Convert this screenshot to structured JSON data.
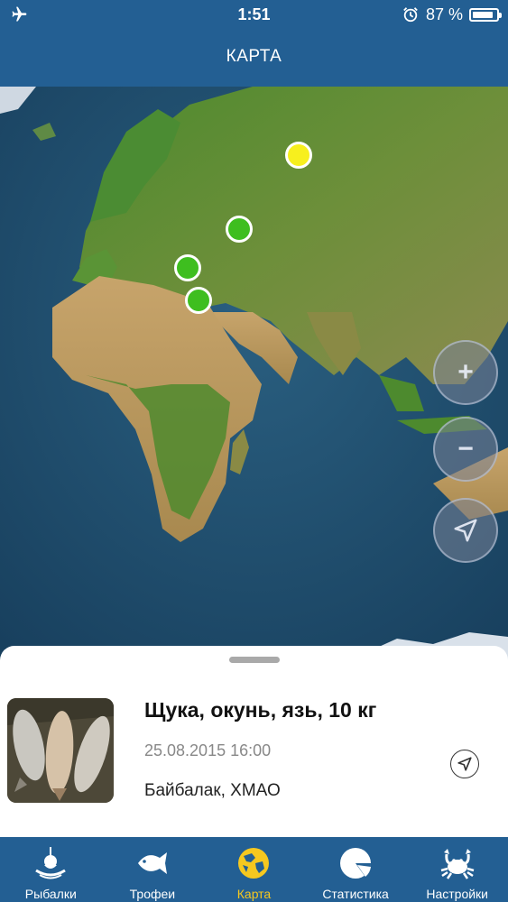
{
  "status_bar": {
    "time": "1:51",
    "battery_text": "87 %",
    "battery_level": 0.87,
    "left_icon": "airplane-icon",
    "alarm_icon": "alarm-icon"
  },
  "header": {
    "title": "КАРТА"
  },
  "map": {
    "markers": [
      {
        "color": "#f7ef1e",
        "icon": "catch-marker-yellow"
      },
      {
        "color": "#3ebe1f",
        "icon": "catch-marker-green"
      },
      {
        "color": "#3ebe1f",
        "icon": "catch-marker-green"
      },
      {
        "color": "#3ebe1f",
        "icon": "catch-marker-green"
      }
    ],
    "controls": [
      {
        "name": "zoom-in-button",
        "glyph": "+"
      },
      {
        "name": "zoom-out-button",
        "glyph": "−"
      },
      {
        "name": "my-location-button",
        "glyph": "location-arrow-icon"
      }
    ]
  },
  "card": {
    "title": "Щука, окунь, язь, 10 кг",
    "datetime": "25.08.2015 16:00",
    "place": "Байбалак, ХМАО"
  },
  "tabbar": {
    "active_color": "#f6c81f",
    "tabs": [
      {
        "label": "Рыбалки",
        "icon": "bobber-icon",
        "active": false
      },
      {
        "label": "Трофеи",
        "icon": "fish-icon",
        "active": false
      },
      {
        "label": "Карта",
        "icon": "globe-icon",
        "active": true
      },
      {
        "label": "Статистика",
        "icon": "pie-chart-icon",
        "active": false
      },
      {
        "label": "Настройки",
        "icon": "crab-icon",
        "active": false
      }
    ]
  },
  "colors": {
    "bar": "#235f93",
    "ocean": "#1e4b6d"
  }
}
